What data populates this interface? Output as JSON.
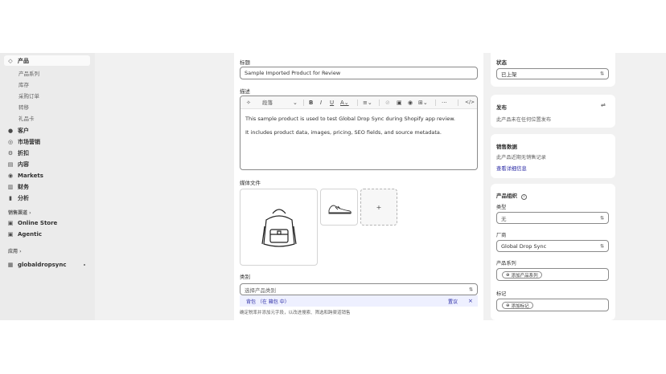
{
  "sidebar": {
    "items": [
      {
        "label": "产品",
        "icon": "tag-icon"
      },
      {
        "label": "客户",
        "icon": "person-icon"
      },
      {
        "label": "市场营销",
        "icon": "target-icon"
      },
      {
        "label": "折扣",
        "icon": "discount-icon"
      },
      {
        "label": "内容",
        "icon": "content-icon"
      },
      {
        "label": "Markets",
        "icon": "globe-icon"
      },
      {
        "label": "财务",
        "icon": "bank-icon"
      },
      {
        "label": "分析",
        "icon": "chart-icon"
      }
    ],
    "product_sub": [
      "产品系列",
      "库存",
      "采购订单",
      "转移",
      "礼品卡"
    ],
    "sales_channels_label": "销售渠道",
    "sales_channels": [
      {
        "label": "Online Store",
        "icon": "store-icon"
      },
      {
        "label": "Agentic",
        "icon": "agentic-icon"
      }
    ],
    "apps_label": "应用",
    "app_item": {
      "label": "globaldropsync",
      "icon": "app-icon"
    }
  },
  "main": {
    "title_label": "标题",
    "title_value": "Sample Imported Product for Review",
    "description_label": "描述",
    "toolbar": {
      "paragraph": "段落"
    },
    "description_lines": [
      "This sample product is used to test Global Drop Sync during Shopify app review.",
      "It includes product data, images, pricing, SEO fields, and source metadata."
    ],
    "media_label": "媒体文件",
    "media_add": "+",
    "category_label": "类别",
    "category_placeholder": "选择产品类别",
    "category_suggestion": "背包 （在 箱包 中）",
    "suggestion_ignore": "置议",
    "suggestion_close": "×",
    "category_help": "确定税率并添加元字段，以改进搜索、筛选和跨渠道销售"
  },
  "right": {
    "status": {
      "title": "状态",
      "value": "已上架"
    },
    "publish": {
      "title": "发布",
      "text": "此产品未在任何位置发布"
    },
    "sales": {
      "title": "销售数据",
      "text": "此产品近期无销售记录",
      "link": "查看详细信息"
    },
    "org": {
      "title": "产品组织",
      "type_label": "类型",
      "type_value": "无",
      "vendor_label": "厂商",
      "vendor_value": "Global Drop Sync",
      "collections_label": "产品系列",
      "collections_chip": "添加产品系列",
      "tags_label": "标记",
      "tags_chip": "添加标记"
    }
  },
  "colors": {
    "accent": "#2a2aa5",
    "sidebar_bg": "#ebebeb",
    "page_bg": "#f1f1f1"
  }
}
